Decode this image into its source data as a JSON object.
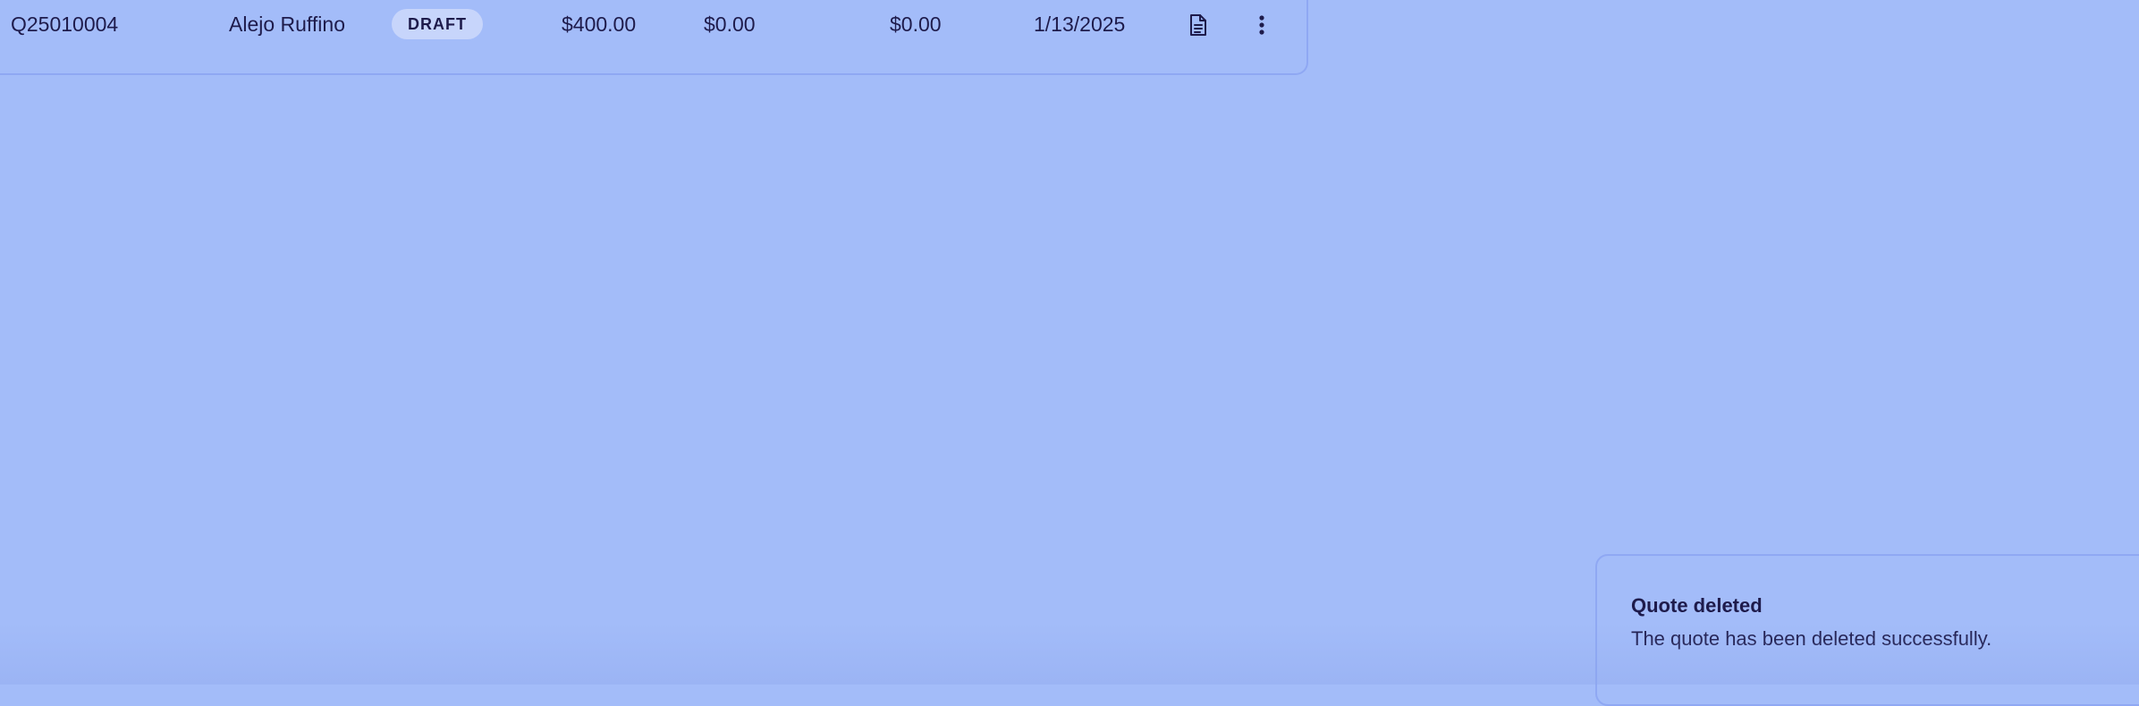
{
  "quotes_table": {
    "rows": [
      {
        "quote_number": "Q25010004",
        "client": "Alejo Ruffino",
        "status": "DRAFT",
        "amount": "$400.00",
        "tax": "$0.00",
        "discount": "$0.00",
        "date": "1/13/2025",
        "actions": {
          "view_icon": "document-icon",
          "more_icon": "more-vertical-icon"
        }
      }
    ]
  },
  "toast": {
    "title": "Quote deleted",
    "message": "The quote has been deleted successfully."
  },
  "colors": {
    "background": "#a3bcf9",
    "border": "#8fa8f3",
    "text": "#1e1b4b",
    "badge_bg": "#c7d5fb"
  }
}
